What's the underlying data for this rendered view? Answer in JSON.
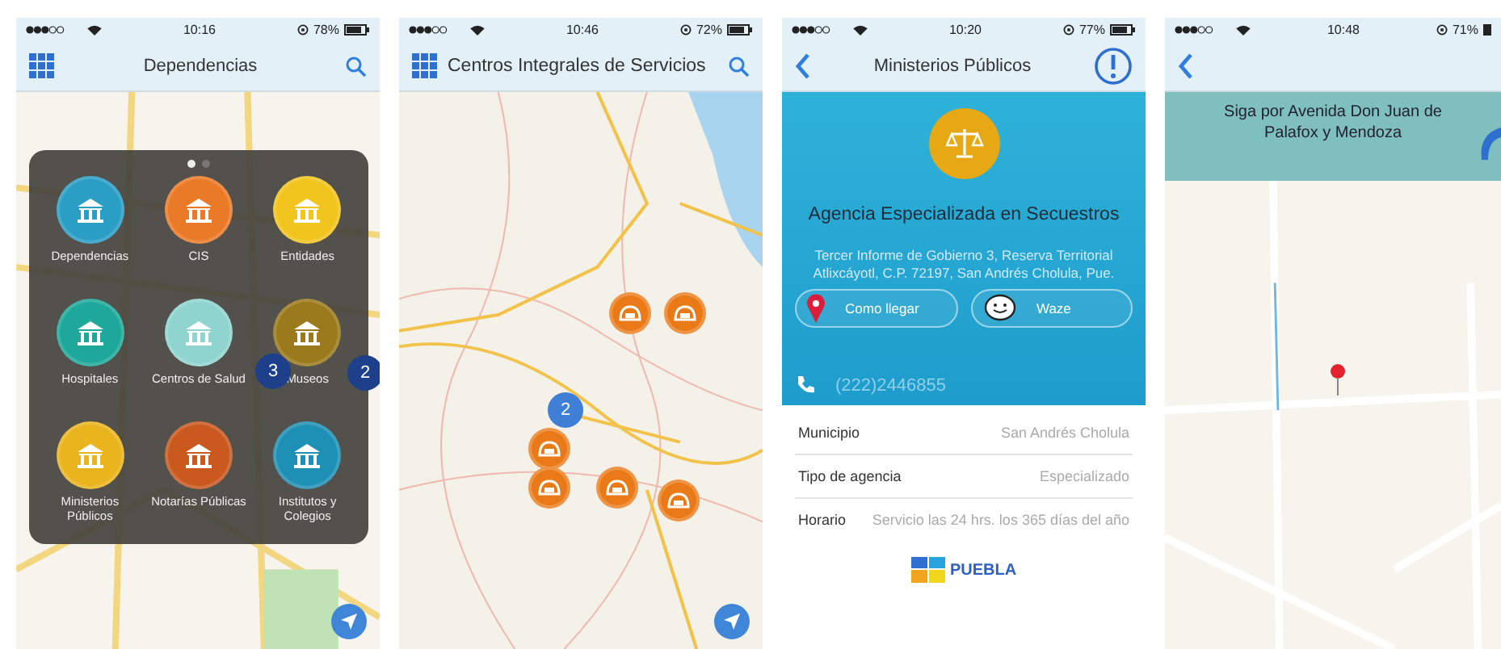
{
  "screens": [
    {
      "kind": "menu_map",
      "status": {
        "time": "10:16",
        "battery": "78%"
      },
      "nav": {
        "title": "Dependencias"
      },
      "menu": {
        "page_dots": [
          {
            "selected": true
          },
          {
            "selected": false
          }
        ],
        "items": [
          {
            "label": "Dependencias",
            "color": "#2a9ec4"
          },
          {
            "label": "CIS",
            "color": "#ea7a28"
          },
          {
            "label": "Entidades",
            "color": "#f2c41e"
          },
          {
            "label": "Hospitales",
            "color": "#1ea89a"
          },
          {
            "label": "Centros de Salud",
            "color": "#8fd4cf"
          },
          {
            "label": "Museos",
            "color": "#9a7a1c"
          },
          {
            "label": "Ministerios Públicos",
            "color": "#e9b41e"
          },
          {
            "label": "Notarías Públicas",
            "color": "#c9591f"
          },
          {
            "label": "Institutos y Colegios",
            "color": "#1f90b5"
          }
        ]
      },
      "clusters": [
        "3",
        "2"
      ]
    },
    {
      "kind": "map",
      "status": {
        "time": "10:46",
        "battery": "72%"
      },
      "nav": {
        "title": "Centros Integrales de Servicios"
      },
      "clusters": [
        "2"
      ]
    },
    {
      "kind": "detail",
      "status": {
        "time": "10:20",
        "battery": "77%"
      },
      "nav": {
        "title": "Ministerios Públicos"
      },
      "name": "Agencia Especializada en Secuestros",
      "address": "Tercer Informe de Gobierno 3, Reserva Territorial Atlixcáyotl, C.P. 72197, San Andrés Cholula, Pue.",
      "buttons": [
        "Como llegar",
        "Waze"
      ],
      "phone": "(222)2446855",
      "fields": [
        {
          "label": "Municipio",
          "value": "San Andrés Cholula"
        },
        {
          "label": "Tipo de agencia",
          "value": "Especializado"
        },
        {
          "label": "Horario",
          "value": "Servicio las 24 hrs. los 365 días del año"
        }
      ],
      "logo": "PUEBLA"
    },
    {
      "kind": "route",
      "status": {
        "time": "10:48",
        "battery": "71%"
      },
      "instruction": "Siga por Avenida Don Juan de Palafox y Mendoza"
    }
  ]
}
